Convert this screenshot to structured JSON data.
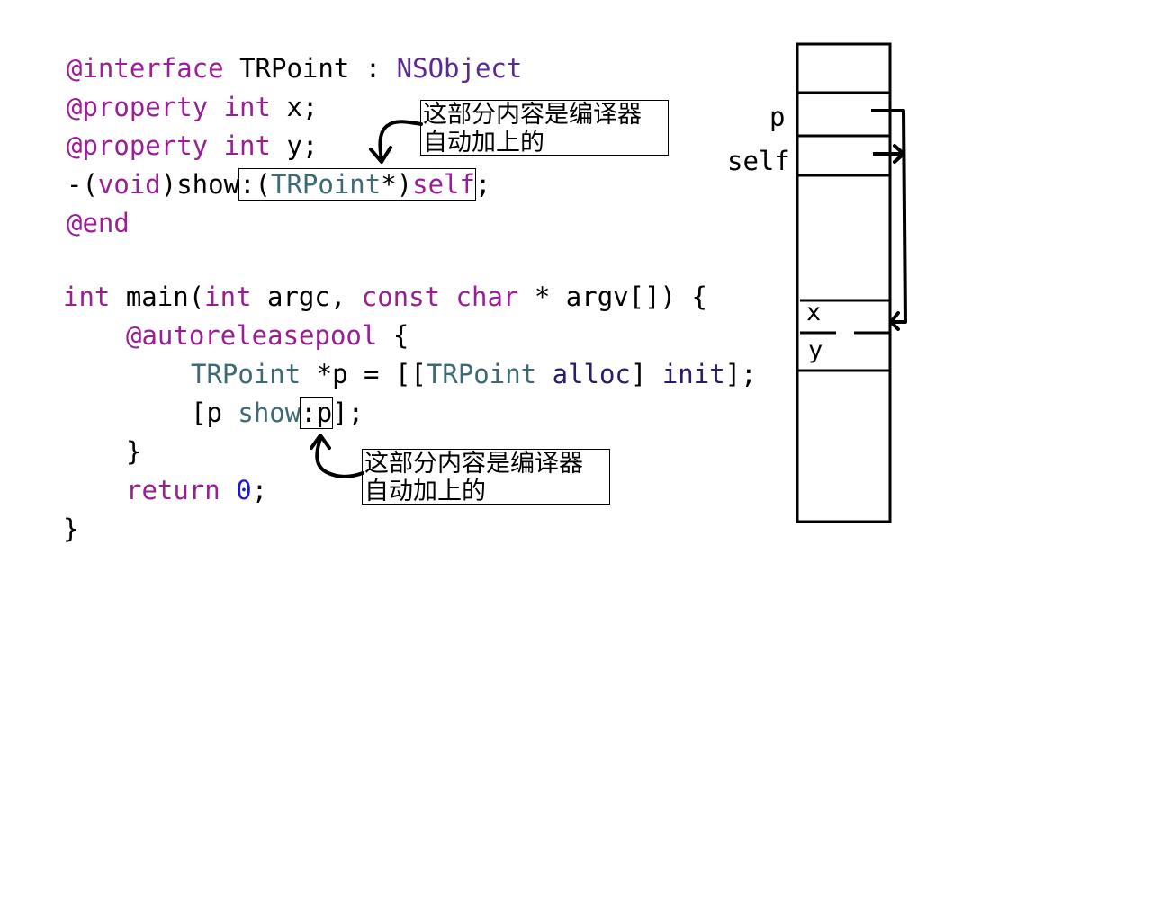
{
  "code": {
    "interface_line": {
      "at_interface": "@interface",
      "class_name": " TRPoint : ",
      "superclass": "NSObject"
    },
    "property_x": {
      "at_property": "@property",
      "type": " int",
      "rest": " x;"
    },
    "property_y": {
      "at_property": "@property",
      "type": " int",
      "rest": " y;"
    },
    "method_decl": {
      "prefix": "-(",
      "void": "void",
      "show": ")show",
      "colon_open": ":(",
      "param_type": "TRPoint",
      "star_close": "*)",
      "self": "self",
      "semicolon": ";"
    },
    "end_line": "@end",
    "main_line": {
      "int1": "int",
      "main": " main(",
      "int2": "int",
      "argc": " argc, ",
      "const": "const",
      "space": " ",
      "char": "char",
      "rest": " * argv[]) {"
    },
    "autorelease_line": {
      "kw": "@autoreleasepool",
      "rest": " {"
    },
    "alloc_line": {
      "type": "TRPoint",
      "p_decl": " *p = [[",
      "type2": "TRPoint",
      "space": " ",
      "alloc": "alloc",
      "mid": "] ",
      "init": "init",
      "end": "];"
    },
    "show_call": {
      "open": "[p ",
      "show": "show",
      "arg": ":p",
      "end": "];"
    },
    "close_brace_inner": "}",
    "return_line": {
      "kw": "return",
      "space": " ",
      "num": "0",
      "end": ";"
    },
    "close_brace_outer": "}"
  },
  "notes": {
    "top": {
      "line1": "这部分内容是编译器",
      "line2": "自动加上的"
    },
    "bottom": {
      "line1": "这部分内容是编译器",
      "line2": "自动加上的"
    }
  },
  "memory": {
    "labels": {
      "p": "p",
      "self": "self",
      "x": "x",
      "y": "y"
    }
  },
  "colors": {
    "keyword": "#9b1f94",
    "class": "#5b2a90",
    "type": "#3d6b73",
    "method": "#2e1a6a",
    "number": "#1b17d6"
  }
}
